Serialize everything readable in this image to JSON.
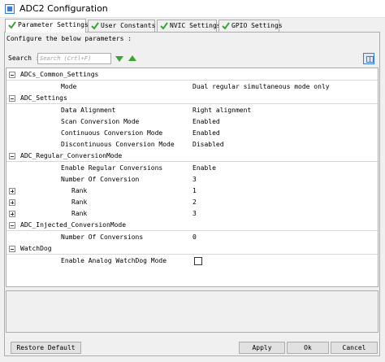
{
  "window": {
    "title": "ADC2 Configuration"
  },
  "tabs": [
    {
      "label": "Parameter Settings",
      "active": true
    },
    {
      "label": "User Constants",
      "active": false
    },
    {
      "label": "NVIC Settings",
      "active": false
    },
    {
      "label": "GPIO Settings",
      "active": false
    }
  ],
  "configure_text": "Configure the below parameters :",
  "search": {
    "label": "Search :",
    "placeholder": "Search (Crtl+F)"
  },
  "tree": {
    "sections": [
      {
        "name": "ADCs_Common_Settings",
        "params": [
          {
            "name": "Mode",
            "value": "Dual regular simultaneous mode only"
          }
        ]
      },
      {
        "name": "ADC_Settings",
        "params": [
          {
            "name": "Data Alignment",
            "value": "Right alignment"
          },
          {
            "name": "Scan Conversion Mode",
            "value": "Enabled"
          },
          {
            "name": "Continuous Conversion Mode",
            "value": "Enabled"
          },
          {
            "name": "Discontinuous Conversion Mode",
            "value": "Disabled"
          }
        ]
      },
      {
        "name": "ADC_Regular_ConversionMode",
        "params": [
          {
            "name": "Enable Regular Conversions",
            "value": "Enable"
          },
          {
            "name": "Number Of Conversion",
            "value": "3"
          },
          {
            "name": "Rank",
            "value": "1"
          },
          {
            "name": "Rank",
            "value": "2"
          },
          {
            "name": "Rank",
            "value": "3"
          }
        ]
      },
      {
        "name": "ADC_Injected_ConversionMode",
        "params": [
          {
            "name": "Number Of Conversions",
            "value": "0"
          }
        ]
      },
      {
        "name": "WatchDog",
        "params": [
          {
            "name": "Enable Analog WatchDog Mode",
            "checked": false
          }
        ]
      }
    ]
  },
  "buttons": {
    "restore_default": "Restore Default",
    "apply": "Apply",
    "ok": "Ok",
    "cancel": "Cancel"
  },
  "colors": {
    "check_green": "#3aa435",
    "arrow_green": "#3aa435",
    "accent_blue": "#3c7ad6"
  }
}
